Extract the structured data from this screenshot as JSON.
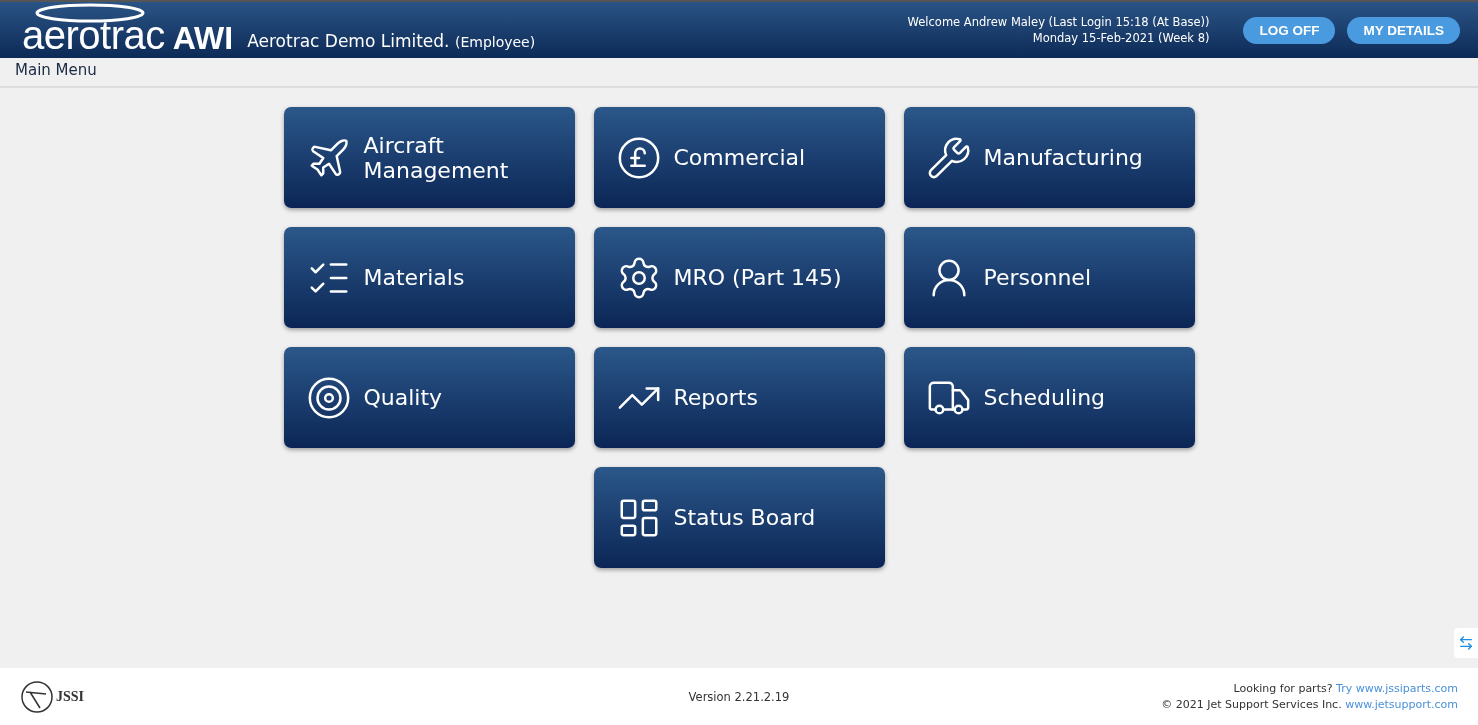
{
  "header": {
    "logo_word": "aerotrac",
    "logo_suffix": "AWI",
    "company": "Aerotrac Demo Limited.",
    "role": "(Employee)",
    "welcome": "Welcome Andrew Maley (Last Login 15:18 (At Base))",
    "date": "Monday 15-Feb-2021 (Week 8)",
    "buttons": [
      "LOG OFF",
      "MY DETAILS"
    ]
  },
  "page_title": "Main Menu",
  "menu_rows": [
    {
      "tiles": [
        "Aircraft Management",
        "Commercial",
        "Manufacturing"
      ]
    },
    {
      "tiles": [
        "Materials",
        "MRO (Part 145)",
        "Personnel"
      ]
    },
    {
      "tiles": [
        "Quality",
        "Reports",
        "Scheduling"
      ]
    },
    {
      "tiles": [
        "Status Board"
      ]
    }
  ],
  "footer": {
    "logo_text": "JSSI",
    "version": "Version 2.21.2.19",
    "parts_prefix": "Looking for parts?",
    "parts_link": "Try www.jssiparts.com",
    "copyright": "© 2021 Jet Support Services Inc.",
    "support_link": "www.jetsupport.com"
  }
}
